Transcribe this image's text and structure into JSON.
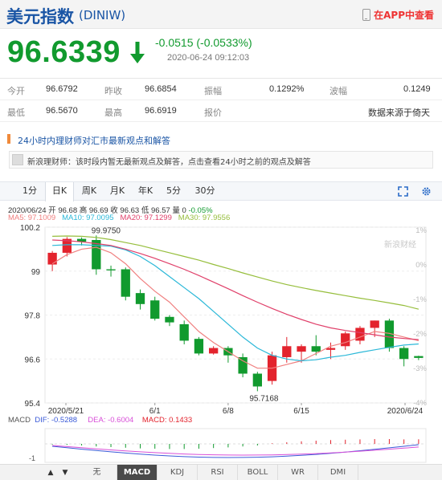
{
  "header": {
    "title": "美元指数",
    "code": "(DINIW)",
    "app_link": "在APP中查看"
  },
  "quote": {
    "price": "96.6339",
    "change": "-0.0515 (-0.0533%)",
    "time": "2020-06-24 09:12:03",
    "direction": "down",
    "down_color": "#119a2e",
    "up_color": "#e3232d"
  },
  "stats": [
    [
      {
        "label": "今开",
        "value": "96.6792"
      },
      {
        "label": "昨收",
        "value": "96.6854"
      },
      {
        "label": "振幅",
        "value": "0.1292%"
      },
      {
        "label": "波幅",
        "value": "0.1249"
      }
    ],
    [
      {
        "label": "最低",
        "value": "96.5670"
      },
      {
        "label": "最高",
        "value": "96.6919"
      },
      {
        "label": "报价",
        "value": ""
      },
      {
        "label": "",
        "value": "数据来源于倚天"
      }
    ]
  ],
  "expert": {
    "label": "24小时内理财师对汇市最新观点和解答",
    "notice": "新浪理财师：该时段内暂无最新观点及解答，点击查看24小时之前的观点及解答"
  },
  "tabs": [
    "1分",
    "日K",
    "周K",
    "月K",
    "年K",
    "5分",
    "30分"
  ],
  "active_tab": "日K",
  "legend": {
    "ohlc": "2020/06/24 开 96.68 高 96.69 收 96.63 低 96.57 量 0",
    "pct": "-0.05%",
    "ma": [
      {
        "text": "MA5: 97.1009",
        "color": "#f08080"
      },
      {
        "text": "MA10: 97.0095",
        "color": "#2bb8d8"
      },
      {
        "text": "MA20: 97.1299",
        "color": "#e0406a"
      },
      {
        "text": "MA30: 97.9556",
        "color": "#96be3c"
      }
    ]
  },
  "watermark": "新浪财经",
  "chart_data": {
    "type": "candlestick",
    "yticks": [
      "100.2",
      "99",
      "97.8",
      "96.6",
      "95.4"
    ],
    "ylim": [
      95.4,
      100.2
    ],
    "pct_ticks": [
      "1%",
      "0%",
      "-1%",
      "-2%",
      "-3%",
      "-4%"
    ],
    "xticks": [
      "2020/5/21",
      "6/1",
      "6/8",
      "6/15",
      "2020/6/24"
    ],
    "annotations": {
      "high": "99.9750",
      "low": "95.7168"
    },
    "candles": [
      {
        "date": "2020/5/21",
        "o": 99.18,
        "h": 99.55,
        "l": 99.0,
        "c": 99.5
      },
      {
        "date": "2020/5/22",
        "o": 99.5,
        "h": 99.93,
        "l": 99.4,
        "c": 99.88
      },
      {
        "date": "2020/5/25",
        "o": 99.88,
        "h": 99.92,
        "l": 99.7,
        "c": 99.8
      },
      {
        "date": "2020/5/26",
        "o": 99.85,
        "h": 99.975,
        "l": 98.9,
        "c": 99.05
      },
      {
        "date": "2020/5/27",
        "o": 99.05,
        "h": 99.15,
        "l": 98.85,
        "c": 99.02
      },
      {
        "date": "2020/5/28",
        "o": 99.05,
        "h": 99.1,
        "l": 98.2,
        "c": 98.3
      },
      {
        "date": "2020/5/29",
        "o": 98.4,
        "h": 98.5,
        "l": 97.95,
        "c": 98.1
      },
      {
        "date": "2020/6/1",
        "o": 98.2,
        "h": 98.3,
        "l": 97.65,
        "c": 97.7
      },
      {
        "date": "2020/6/2",
        "o": 97.75,
        "h": 97.8,
        "l": 97.5,
        "c": 97.6
      },
      {
        "date": "2020/6/3",
        "o": 97.55,
        "h": 97.65,
        "l": 97.0,
        "c": 97.1
      },
      {
        "date": "2020/6/4",
        "o": 97.15,
        "h": 97.2,
        "l": 96.7,
        "c": 96.75
      },
      {
        "date": "2020/6/5",
        "o": 96.75,
        "h": 96.95,
        "l": 96.72,
        "c": 96.9
      },
      {
        "date": "2020/6/8",
        "o": 96.9,
        "h": 96.95,
        "l": 96.5,
        "c": 96.7
      },
      {
        "date": "2020/6/9",
        "o": 96.65,
        "h": 96.75,
        "l": 96.1,
        "c": 96.2
      },
      {
        "date": "2020/6/10",
        "o": 96.2,
        "h": 96.25,
        "l": 95.72,
        "c": 95.85
      },
      {
        "date": "2020/6/11",
        "o": 96.0,
        "h": 96.8,
        "l": 95.9,
        "c": 96.7
      },
      {
        "date": "2020/6/12",
        "o": 96.65,
        "h": 97.2,
        "l": 96.5,
        "c": 96.95
      },
      {
        "date": "2020/6/15",
        "o": 96.8,
        "h": 97.0,
        "l": 96.5,
        "c": 96.95
      },
      {
        "date": "2020/6/16",
        "o": 96.95,
        "h": 97.25,
        "l": 96.7,
        "c": 96.8
      },
      {
        "date": "2020/6/17",
        "o": 96.85,
        "h": 97.05,
        "l": 96.6,
        "c": 96.9
      },
      {
        "date": "2020/6/18",
        "o": 96.95,
        "h": 97.35,
        "l": 96.85,
        "c": 97.3
      },
      {
        "date": "2020/6/19",
        "o": 97.1,
        "h": 97.5,
        "l": 97.0,
        "c": 97.45
      },
      {
        "date": "2020/6/22",
        "o": 97.45,
        "h": 97.65,
        "l": 97.2,
        "c": 97.65
      },
      {
        "date": "2020/6/23",
        "o": 97.65,
        "h": 97.7,
        "l": 96.8,
        "c": 96.9
      },
      {
        "date": "2020/6/24",
        "o": 96.9,
        "h": 96.95,
        "l": 96.4,
        "c": 96.6
      },
      {
        "date": "2020/6/24 cur",
        "o": 96.68,
        "h": 96.69,
        "l": 96.57,
        "c": 96.63
      }
    ],
    "ma_series": [
      {
        "name": "MA5",
        "color": "#f08080",
        "values": [
          99.2,
          99.45,
          99.6,
          99.65,
          99.5,
          99.2,
          98.8,
          98.45,
          98.15,
          97.75,
          97.35,
          97.05,
          96.8,
          96.55,
          96.35,
          96.35,
          96.45,
          96.55,
          96.75,
          96.95,
          97.05,
          97.2,
          97.35,
          97.3,
          97.2,
          97.1
        ]
      },
      {
        "name": "MA10",
        "color": "#2bb8d8",
        "values": [
          99.7,
          99.72,
          99.72,
          99.7,
          99.68,
          99.58,
          99.4,
          99.15,
          98.85,
          98.55,
          98.25,
          97.9,
          97.55,
          97.2,
          96.9,
          96.7,
          96.6,
          96.55,
          96.58,
          96.65,
          96.7,
          96.78,
          96.85,
          96.92,
          96.98,
          97.01
        ]
      },
      {
        "name": "MA20",
        "color": "#e0406a",
        "values": [
          99.85,
          99.83,
          99.8,
          99.75,
          99.7,
          99.6,
          99.48,
          99.35,
          99.2,
          99.05,
          98.88,
          98.7,
          98.52,
          98.33,
          98.15,
          97.98,
          97.82,
          97.68,
          97.55,
          97.45,
          97.38,
          97.32,
          97.26,
          97.2,
          97.16,
          97.13
        ]
      },
      {
        "name": "MA30",
        "color": "#96be3c",
        "values": [
          99.95,
          99.96,
          99.95,
          99.92,
          99.86,
          99.78,
          99.7,
          99.6,
          99.5,
          99.4,
          99.3,
          99.18,
          99.07,
          98.95,
          98.84,
          98.73,
          98.63,
          98.55,
          98.47,
          98.4,
          98.33,
          98.26,
          98.2,
          98.13,
          98.06,
          97.96
        ]
      }
    ],
    "macd": {
      "label": "MACD",
      "dif": {
        "text": "DIF: -0.5288",
        "color": "#3b5bd8"
      },
      "dea": {
        "text": "DEA: -0.6004",
        "color": "#d84fd8"
      },
      "macd": {
        "text": "MACD: 0.1433",
        "color": "#e3232d"
      },
      "yticks": [
        "-1"
      ],
      "hist": [
        -0.02,
        -0.03,
        -0.05,
        -0.08,
        -0.1,
        -0.12,
        -0.14,
        -0.15,
        -0.16,
        -0.16,
        -0.15,
        -0.13,
        -0.11,
        -0.08,
        -0.05,
        0.02,
        0.05,
        0.08,
        0.1,
        0.12,
        0.13,
        0.14,
        0.15,
        0.15,
        0.14,
        0.143
      ]
    }
  },
  "indicator_tabs": [
    "无",
    "MACD",
    "KDJ",
    "RSI",
    "BOLL",
    "WR",
    "DMI"
  ],
  "active_indicator": "MACD"
}
